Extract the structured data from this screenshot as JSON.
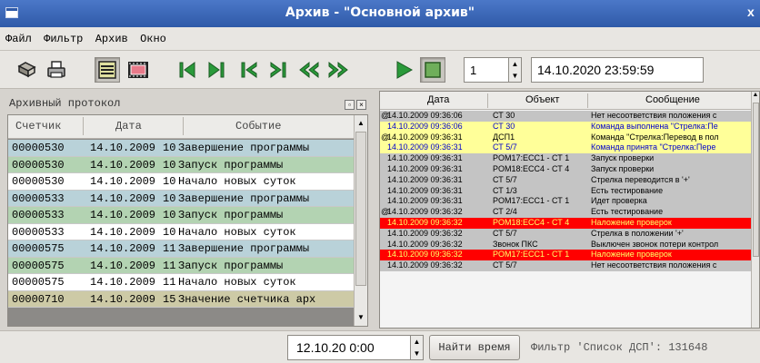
{
  "window": {
    "title": "Архив - \"Основной архив\"",
    "close_glyph": "x"
  },
  "menu": [
    "Файл",
    "Фильтр",
    "Архив",
    "Окно"
  ],
  "toolbar": {
    "buttons": [
      {
        "name": "open-archive-icon"
      },
      {
        "name": "print-icon"
      },
      {
        "name": "list-view-icon",
        "pressed": true
      },
      {
        "name": "film-view-icon"
      },
      {
        "name": "first-icon"
      },
      {
        "name": "last-icon"
      },
      {
        "name": "prev-icon"
      },
      {
        "name": "next-icon"
      },
      {
        "name": "rewind-icon"
      },
      {
        "name": "fast-forward-icon"
      },
      {
        "name": "play-icon"
      },
      {
        "name": "stop-icon"
      }
    ],
    "speed_value": "1",
    "current_datetime": "14.10.2020 23:59:59"
  },
  "left_panel": {
    "title": "Архивный протокол",
    "columns": [
      "Счетчик",
      "Дата",
      "Событие"
    ],
    "rows": [
      {
        "counter": "00000530",
        "date": "14.10.2009",
        "time": "10",
        "event": "Завершение программы",
        "bg": "#b9d2d9"
      },
      {
        "counter": "00000530",
        "date": "14.10.2009",
        "time": "10",
        "event": "Запуск программы",
        "bg": "#b3d3b2"
      },
      {
        "counter": "00000530",
        "date": "14.10.2009",
        "time": "10",
        "event": "Начало новых суток",
        "bg": "#ffffff"
      },
      {
        "counter": "00000533",
        "date": "14.10.2009",
        "time": "10",
        "event": "Завершение программы",
        "bg": "#b9d2d9"
      },
      {
        "counter": "00000533",
        "date": "14.10.2009",
        "time": "10",
        "event": "Запуск программы",
        "bg": "#b3d3b2"
      },
      {
        "counter": "00000533",
        "date": "14.10.2009",
        "time": "10",
        "event": "Начало новых суток",
        "bg": "#ffffff"
      },
      {
        "counter": "00000575",
        "date": "14.10.2009",
        "time": "11",
        "event": "Завершение программы",
        "bg": "#b9d2d9"
      },
      {
        "counter": "00000575",
        "date": "14.10.2009",
        "time": "11",
        "event": "Запуск программы",
        "bg": "#b3d3b2"
      },
      {
        "counter": "00000575",
        "date": "14.10.2009",
        "time": "11",
        "event": "Начало новых суток",
        "bg": "#ffffff"
      },
      {
        "counter": "00000710",
        "date": "14.10.2009",
        "time": "15",
        "event": "Значение счетчика арх",
        "bg": "#cdcaa6"
      }
    ]
  },
  "right_panel": {
    "columns": [
      "Дата",
      "Объект",
      "Сообщение"
    ],
    "rows": [
      {
        "mark": "@",
        "date": "14.10.2009 09:36:06",
        "object": "СТ 30",
        "message": "Нет несоответствия положения с",
        "bg": "#c4c4c4",
        "fg": "#000000"
      },
      {
        "mark": "",
        "date": "14.10.2009 09:36:06",
        "object": "СТ 30",
        "message": "Команда выполнена \"Стрелка:Пе",
        "bg": "#ffff99",
        "fg": "#0000cc"
      },
      {
        "mark": "@",
        "date": "14.10.2009 09:36:31",
        "object": "ДСП1",
        "message": "Команда \"Стрелка:Перевод в пол",
        "bg": "#ffff99",
        "fg": "#000000"
      },
      {
        "mark": "",
        "date": "14.10.2009 09:36:31",
        "object": "СТ 5/7",
        "message": "Команда принята \"Стрелка:Пере",
        "bg": "#ffff99",
        "fg": "#0000cc"
      },
      {
        "mark": "",
        "date": "14.10.2009 09:36:31",
        "object": "POM17:ECC1 - СТ 1",
        "message": "Запуск проверки",
        "bg": "#c4c4c4",
        "fg": "#000000"
      },
      {
        "mark": "",
        "date": "14.10.2009 09:36:31",
        "object": "POM18:ECC4 - СТ 4",
        "message": "Запуск проверки",
        "bg": "#c4c4c4",
        "fg": "#000000"
      },
      {
        "mark": "",
        "date": "14.10.2009 09:36:31",
        "object": "СТ 5/7",
        "message": "Стрелка переводится в '+'",
        "bg": "#c4c4c4",
        "fg": "#000000"
      },
      {
        "mark": "",
        "date": "14.10.2009 09:36:31",
        "object": "СТ 1/3",
        "message": "Есть тестирование",
        "bg": "#c4c4c4",
        "fg": "#000000"
      },
      {
        "mark": "",
        "date": "14.10.2009 09:36:31",
        "object": "POM17:ECC1 - СТ 1",
        "message": "Идет проверка",
        "bg": "#c4c4c4",
        "fg": "#000000"
      },
      {
        "mark": "@",
        "date": "14.10.2009 09:36:32",
        "object": "СТ 2/4",
        "message": "Есть тестирование",
        "bg": "#c4c4c4",
        "fg": "#000000"
      },
      {
        "mark": "",
        "date": "14.10.2009 09:36:32",
        "object": "POM18:ECC4 - СТ 4",
        "message": "Наложение проверок",
        "bg": "#ff0000",
        "fg": "#ffff66"
      },
      {
        "mark": "",
        "date": "14.10.2009 09:36:32",
        "object": "СТ 5/7",
        "message": "Стрелка в положении '+'",
        "bg": "#c4c4c4",
        "fg": "#000000"
      },
      {
        "mark": "",
        "date": "14.10.2009 09:36:32",
        "object": "Звонок ПКС",
        "message": "Выключен звонок потери контрол",
        "bg": "#c4c4c4",
        "fg": "#000000"
      },
      {
        "mark": "",
        "date": "14.10.2009 09:36:32",
        "object": "POM17:ECC1 - СТ 1",
        "message": "Наложение проверок",
        "bg": "#ff0000",
        "fg": "#ffff66"
      },
      {
        "mark": "",
        "date": "14.10.2009 09:36:32",
        "object": "СТ 5/7",
        "message": "Нет несоответствия положения с",
        "bg": "#c4c4c4",
        "fg": "#000000"
      }
    ]
  },
  "bottom": {
    "datetime_value": "12.10.20  0:00",
    "find_button": "Найти время",
    "filter_status": "Фильтр 'Список ДСП': 131648"
  }
}
